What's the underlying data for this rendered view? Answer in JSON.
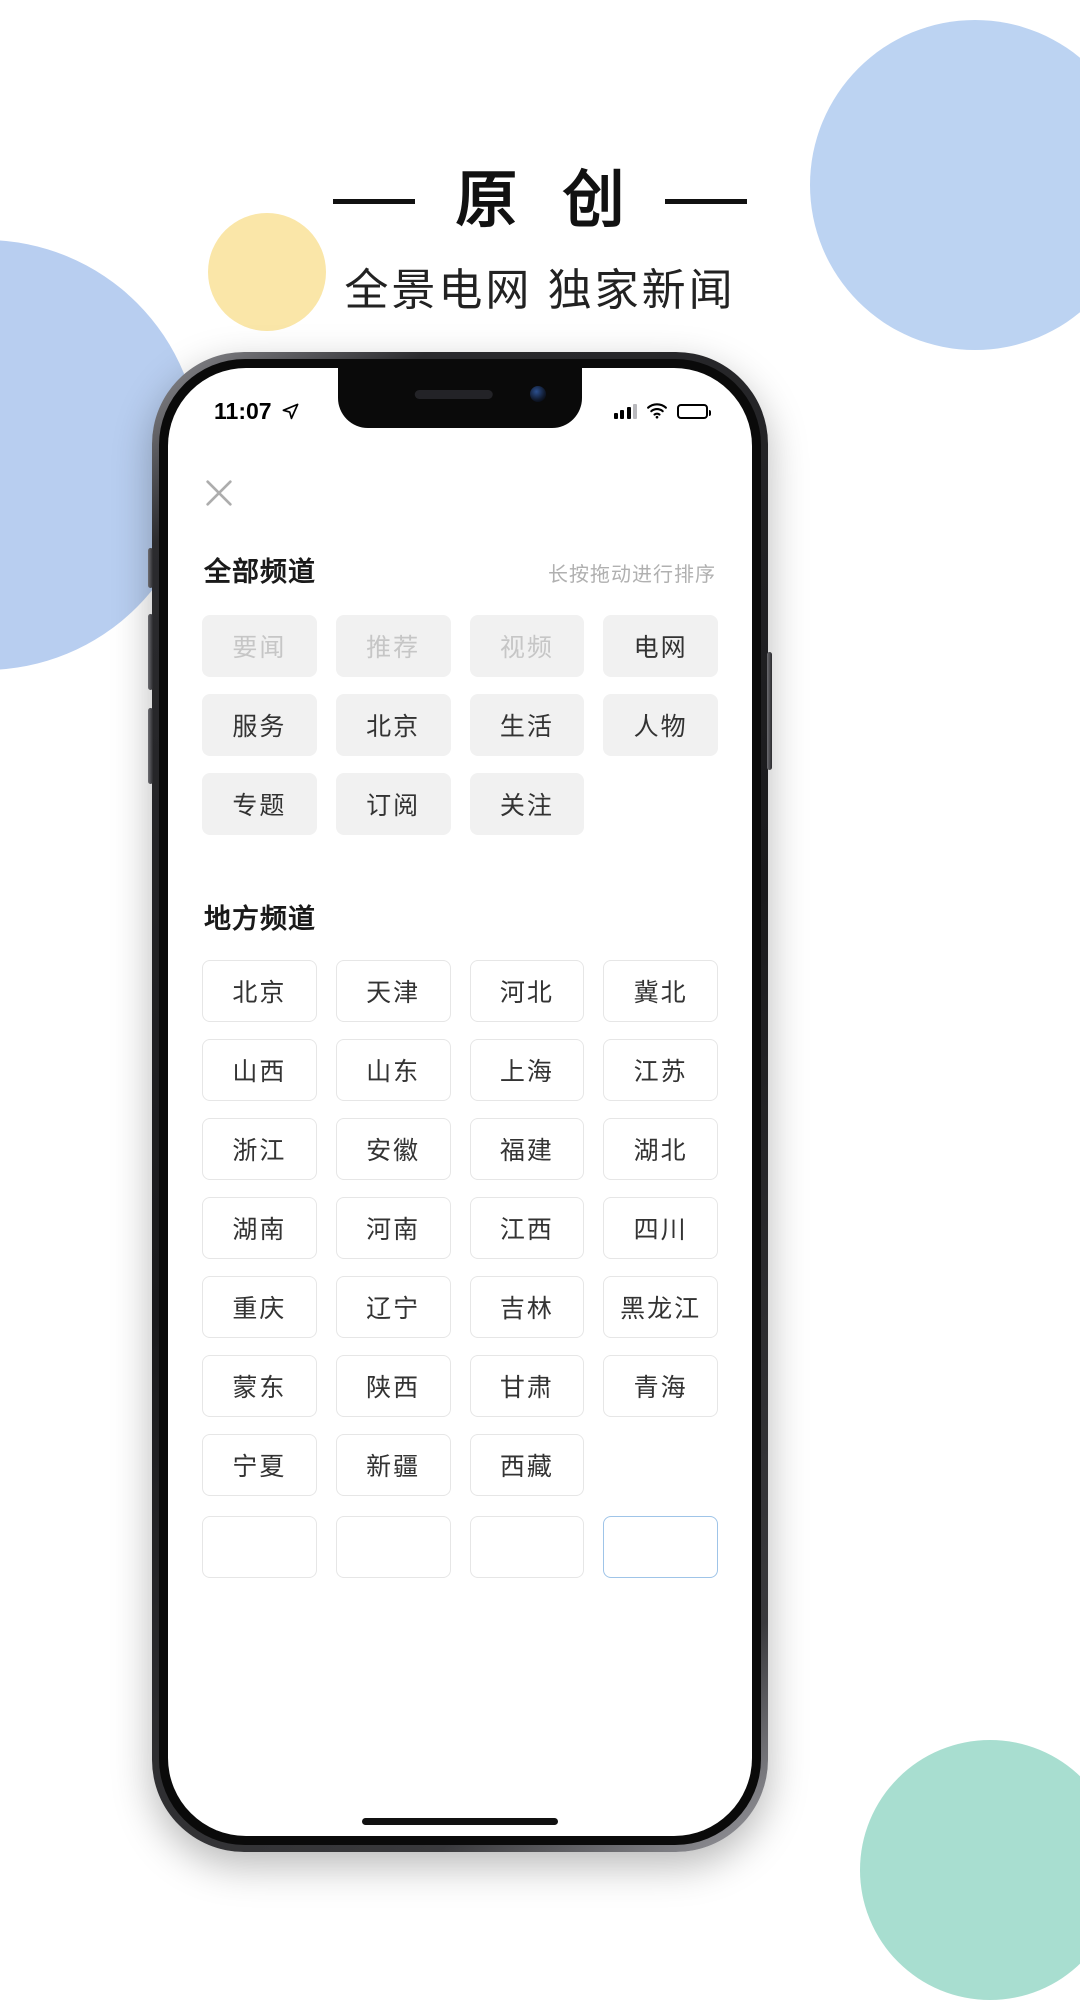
{
  "poster": {
    "title": "原 创",
    "subtitle": "全景电网 独家新闻"
  },
  "statusbar": {
    "time": "11:07",
    "location_icon": "location-arrow-icon",
    "signal_icon": "cellular-signal-icon",
    "wifi_icon": "wifi-icon",
    "battery_icon": "battery-low-icon"
  },
  "app": {
    "close_icon": "close-icon",
    "all_channels": {
      "title": "全部频道",
      "hint": "长按拖动进行排序",
      "items": [
        {
          "label": "要闻",
          "fixed": true
        },
        {
          "label": "推荐",
          "fixed": true
        },
        {
          "label": "视频",
          "fixed": true
        },
        {
          "label": "电网",
          "fixed": false
        },
        {
          "label": "服务",
          "fixed": false
        },
        {
          "label": "北京",
          "fixed": false
        },
        {
          "label": "生活",
          "fixed": false
        },
        {
          "label": "人物",
          "fixed": false
        },
        {
          "label": "专题",
          "fixed": false
        },
        {
          "label": "订阅",
          "fixed": false
        },
        {
          "label": "关注",
          "fixed": false
        }
      ]
    },
    "local_channels": {
      "title": "地方频道",
      "items": [
        {
          "label": "北京"
        },
        {
          "label": "天津"
        },
        {
          "label": "河北"
        },
        {
          "label": "冀北"
        },
        {
          "label": "山西"
        },
        {
          "label": "山东"
        },
        {
          "label": "上海"
        },
        {
          "label": "江苏"
        },
        {
          "label": "浙江"
        },
        {
          "label": "安徽"
        },
        {
          "label": "福建"
        },
        {
          "label": "湖北"
        },
        {
          "label": "湖南"
        },
        {
          "label": "河南"
        },
        {
          "label": "江西"
        },
        {
          "label": "四川"
        },
        {
          "label": "重庆"
        },
        {
          "label": "辽宁"
        },
        {
          "label": "吉林"
        },
        {
          "label": "黑龙江"
        },
        {
          "label": "蒙东"
        },
        {
          "label": "陕西"
        },
        {
          "label": "甘肃"
        },
        {
          "label": "青海"
        },
        {
          "label": "宁夏"
        },
        {
          "label": "新疆"
        },
        {
          "label": "西藏"
        }
      ]
    },
    "peek_row": [
      {
        "label": "",
        "accent": false
      },
      {
        "label": "",
        "accent": false
      },
      {
        "label": "",
        "accent": false
      },
      {
        "label": "",
        "accent": true
      }
    ]
  },
  "colors": {
    "blue_blob": "#b8cef0",
    "yellow_blob": "#fae6a8",
    "teal_blob": "#a8ded0",
    "battery_red": "#ea3b33",
    "chip_fill": "#f1f1f1",
    "chip_border": "#e6e6e6"
  }
}
